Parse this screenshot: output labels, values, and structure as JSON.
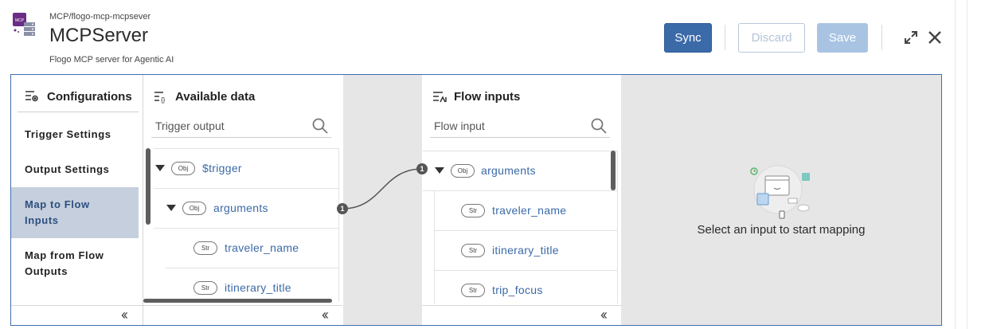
{
  "header": {
    "breadcrumb": "MCP/flogo-mcp-mcpsever",
    "title": "MCPServer",
    "subtitle": "Flogo MCP server for Agentic AI",
    "logo_text": "MCP",
    "buttons": {
      "sync": "Sync",
      "discard": "Discard",
      "save": "Save"
    },
    "icons": [
      "expand-icon",
      "close-icon"
    ]
  },
  "sidebar": {
    "heading": "Configurations",
    "items": [
      {
        "label": "Trigger Settings",
        "active": false
      },
      {
        "label": "Output Settings",
        "active": false
      },
      {
        "label": "Map to Flow Inputs",
        "active": true
      },
      {
        "label": "Map from Flow Outputs",
        "active": false
      }
    ]
  },
  "available_data": {
    "heading": "Available data",
    "search_placeholder": "Trigger output",
    "tree": [
      {
        "type": "Obj",
        "name": "$trigger"
      },
      {
        "type": "Obj",
        "name": "arguments",
        "mapping_badge": "1"
      },
      {
        "type": "Str",
        "name": "traveler_name"
      },
      {
        "type": "Str",
        "name": "itinerary_title"
      }
    ]
  },
  "flow_inputs": {
    "heading": "Flow inputs",
    "search_placeholder": "Flow input",
    "tree": [
      {
        "type": "Obj",
        "name": "arguments",
        "mapping_badge": "1"
      },
      {
        "type": "Str",
        "name": "traveler_name"
      },
      {
        "type": "Str",
        "name": "itinerary_title"
      },
      {
        "type": "Str",
        "name": "trip_focus"
      }
    ]
  },
  "mapping_panel": {
    "empty_message": "Select an input to start mapping"
  },
  "colors": {
    "accent": "#3b6aa8",
    "active_nav": "#c5cfdd",
    "panel_gray": "#e6e6e6"
  }
}
